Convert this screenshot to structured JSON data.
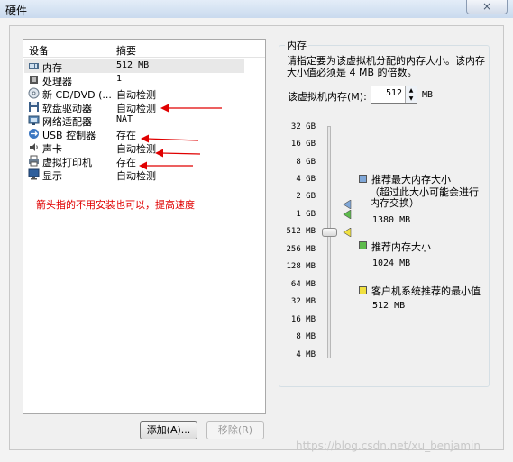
{
  "window": {
    "title": "硬件",
    "close_glyph": "×"
  },
  "list": {
    "col_device": "设备",
    "col_summary": "摘要",
    "rows": [
      {
        "name": "内存",
        "value": "512 MB",
        "icon": "memory-icon"
      },
      {
        "name": "处理器",
        "value": "1",
        "icon": "cpu-icon"
      },
      {
        "name": "新 CD/DVD (...",
        "value": "自动检测",
        "icon": "cd-icon"
      },
      {
        "name": "软盘驱动器",
        "value": "自动检测",
        "icon": "floppy-icon"
      },
      {
        "name": "网络适配器",
        "value": "NAT",
        "icon": "network-icon"
      },
      {
        "name": "USB 控制器",
        "value": "存在",
        "icon": "usb-icon"
      },
      {
        "name": "声卡",
        "value": "自动检测",
        "icon": "sound-icon"
      },
      {
        "name": "虚拟打印机",
        "value": "存在",
        "icon": "printer-icon"
      },
      {
        "name": "显示",
        "value": "自动检测",
        "icon": "display-icon"
      }
    ],
    "annotation": "箭头指的不用安装也可以，提高速度",
    "annotation_color": "#e00000"
  },
  "buttons": {
    "add": "添加(A)...",
    "remove": "移除(R)"
  },
  "memory": {
    "title": "内存",
    "description": "请指定要为该虚拟机分配的内存大小。该内存大小值必须是 4 MB 的倍数。",
    "field_label": "该虚拟机内存(M):",
    "value": "512",
    "unit": "MB",
    "scale": [
      "32 GB",
      "16 GB",
      "8 GB",
      "4 GB",
      "2 GB",
      "1 GB",
      "512 MB",
      "256 MB",
      "128 MB",
      "64 MB",
      "32 MB",
      "16 MB",
      "8 MB",
      "4 MB"
    ],
    "legend": [
      {
        "label": "推荐最大内存大小",
        "note": "（超过此大小可能会进行内存交换）",
        "value": "1380 MB",
        "color": "#7fa7d8"
      },
      {
        "label": "推荐内存大小",
        "note": "",
        "value": "1024 MB",
        "color": "#5dbb4b"
      },
      {
        "label": "客户机系统推荐的最小值",
        "note": "",
        "value": "512 MB",
        "color": "#f0e040"
      }
    ]
  },
  "watermark": "https://blog.csdn.net/xu_benjamin"
}
